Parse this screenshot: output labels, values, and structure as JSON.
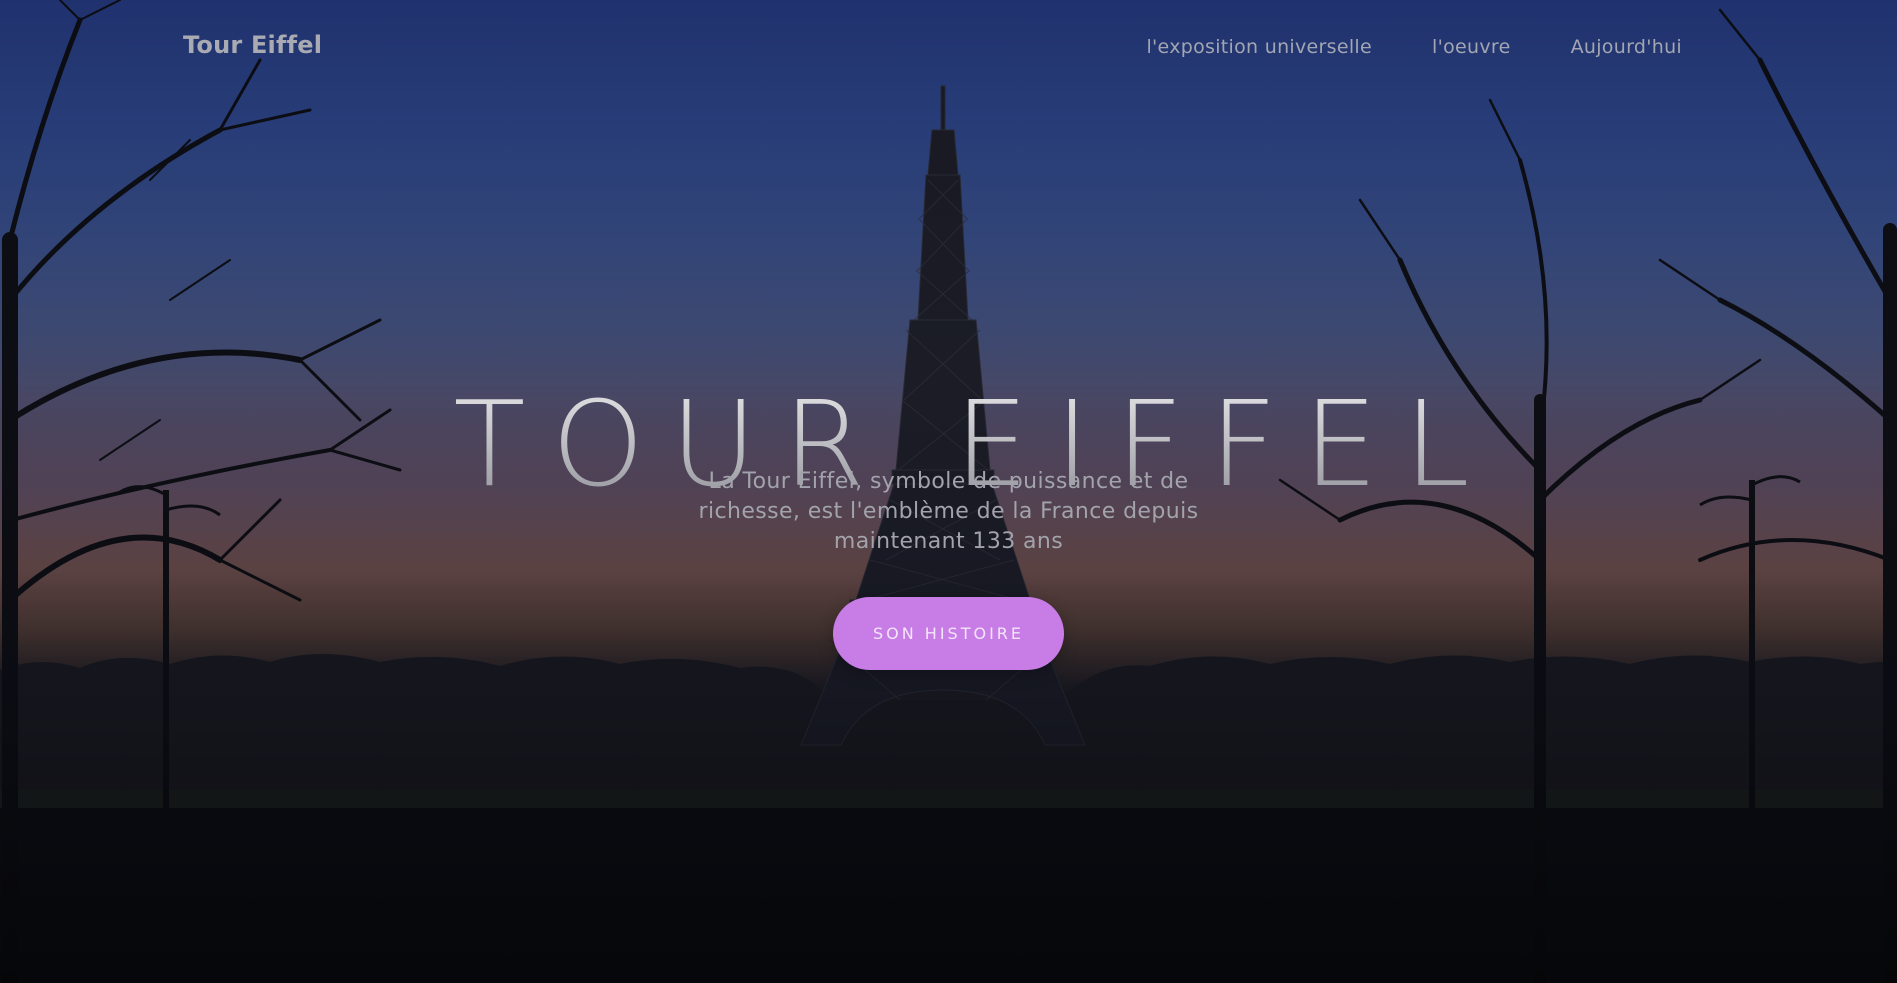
{
  "nav": {
    "brand": "Tour Eiffel",
    "links": [
      {
        "label": "l'exposition universelle"
      },
      {
        "label": "l'oeuvre"
      },
      {
        "label": "Aujourd'hui"
      }
    ]
  },
  "hero": {
    "title": "TOUR EIFFEL",
    "subtitle": "La Tour Eiffel, symbole de puissance et de richesse, est l'emblème de la France depuis maintenant 133 ans",
    "cta_label": "SON HISTOIRE"
  },
  "colors": {
    "cta_background": "#c77ce6",
    "sky_top": "#24397e",
    "horizon": "#6a4c4a",
    "ground": "#0a0b10"
  }
}
